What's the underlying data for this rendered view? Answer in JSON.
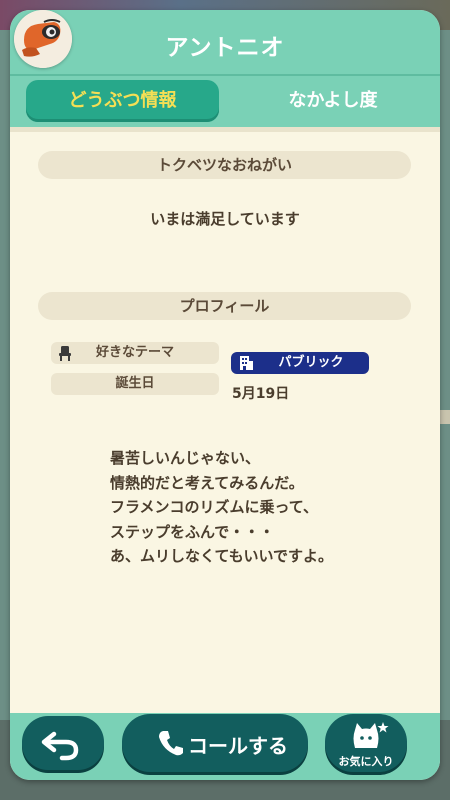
{
  "header": {
    "title": "アントニオ",
    "avatar_icon": "anteater-portrait-icon"
  },
  "tabs": [
    {
      "label": "どうぶつ情報",
      "active": true
    },
    {
      "label": "なかよし度",
      "active": false
    }
  ],
  "special_request": {
    "heading": "トクベツなおねがい",
    "text": "いまは満足しています"
  },
  "profile": {
    "heading": "プロフィール",
    "theme_label": "好きなテーマ",
    "theme_value": "パブリック",
    "birthday_label": "誕生日",
    "birthday_value": "5月19日"
  },
  "quote_lines": [
    "暑苦しいんじゃない、",
    "情熱的だと考えてみるんだ。",
    "フラメンコのリズムに乗って、",
    "ステップをふんで・・・",
    "あ、ムリしなくてもいいですよ。"
  ],
  "footer": {
    "back_icon": "back-arrow-icon",
    "call_label": "コールする",
    "call_icon": "phone-icon",
    "favorite_label": "お気に入り",
    "favorite_icon": "cat-star-icon"
  },
  "colors": {
    "header_mint": "#7ad1b6",
    "tab_active": "#27a88a",
    "tab_active_text": "#f5df55",
    "button_teal": "#125e5e",
    "card_cream": "#faf6e3",
    "theme_badge": "#1c2f8a"
  }
}
